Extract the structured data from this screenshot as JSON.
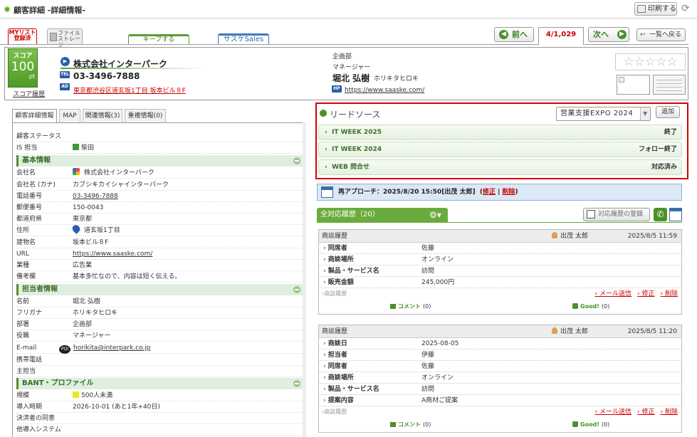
{
  "header": {
    "title": "顧客詳細 -詳細情報-",
    "print_label": "印刷する"
  },
  "toolbar": {
    "mylist_label": "MYリスト",
    "mylist_sub": "登録済",
    "file_label": "ファイル",
    "file_sub": "ストレージ",
    "keep_label": "キープする",
    "sales_label": "サスケSales"
  },
  "pager": {
    "prev_label": "前へ",
    "count": "4/1,029",
    "next_label": "次へ",
    "back_label": "一覧へ戻る"
  },
  "customer": {
    "score_label": "スコア",
    "score_value": "100",
    "score_unit": "pt",
    "score_history": "スコア履歴",
    "company": "株式会社インターパーク",
    "tel_icon": "TEL",
    "tel": "03-3496-7888",
    "address_icon": "AD",
    "address": "東京都渋谷区道玄坂1丁目 坂本ビル８F",
    "department": "企画部",
    "role": "マネージャー",
    "person": "堀北 弘樹",
    "person_kana": "ホリキタヒロキ",
    "url_icon": "HP",
    "url": "https://www.saaske.com/",
    "stars": "☆☆☆☆☆"
  },
  "left_tabs": [
    "顧客詳細情報",
    "MAP",
    "関連情報(3)",
    "重複情報(0)"
  ],
  "details": {
    "status_label": "顧客ステータス",
    "is_label": "IS 担当",
    "is_value": "柴田",
    "is_color": "#3a9a3a",
    "basic_section": "基本情報",
    "basic": [
      {
        "k": "会社名",
        "v": "株式会社インターパーク"
      },
      {
        "k": "会社名 (カナ)",
        "v": "カブシキカイシャインターパーク"
      },
      {
        "k": "電話番号",
        "v": "03-3496-7888"
      },
      {
        "k": "郵便番号",
        "v": "150-0043"
      },
      {
        "k": "都道府県",
        "v": "東京都"
      },
      {
        "k": "住所",
        "v": "道玄坂1丁目"
      },
      {
        "k": "建物名",
        "v": "坂本ビル８F"
      },
      {
        "k": "URL",
        "v": "https://www.saaske.com/"
      },
      {
        "k": "業種",
        "v": "広告業"
      },
      {
        "k": "備考欄",
        "v": "基本多忙なので、内容は短く伝える。"
      }
    ],
    "contact_section": "担当者情報",
    "contact": [
      {
        "k": "名前",
        "v": "堀北 弘樹"
      },
      {
        "k": "フリガナ",
        "v": "ホリキタヒロキ"
      },
      {
        "k": "部署",
        "v": "企画部"
      },
      {
        "k": "役職",
        "v": "マネージャー"
      },
      {
        "k": "E-mail",
        "v": "horikita@interpark.co.jp"
      },
      {
        "k": "携帯電話",
        "v": ""
      },
      {
        "k": "主担当",
        "v": ""
      }
    ],
    "bant_section": "BANT・プロファイル",
    "bant": [
      {
        "k": "規模",
        "v": "500人未満"
      },
      {
        "k": "導入時期",
        "v": "2026-10-01 (あと1年+40日)"
      },
      {
        "k": "決済者の同意",
        "v": ""
      },
      {
        "k": "他導入システム",
        "v": ""
      }
    ],
    "scale_color": "#e8e820"
  },
  "lead": {
    "title": "リードソース",
    "select_value": "営業支援EXPO 2024",
    "add_label": "追加",
    "items": [
      {
        "name": "IT WEEK 2025",
        "status": "終了"
      },
      {
        "name": "IT WEEK 2024",
        "status": "フォロー終了"
      },
      {
        "name": "WEB 問合せ",
        "status": "対応済み"
      }
    ]
  },
  "reapproach": {
    "text": "再アプローチ：2025/8/20 15:50[出茂 太郎]",
    "edit": "修正",
    "delete": "削除"
  },
  "history": {
    "tab_label": "全対応履歴（20）",
    "register_label": "対応履歴の登録",
    "cards": [
      {
        "type": "商談履歴",
        "who": "出茂 太郎",
        "datetime": "2025/8/5 11:59",
        "rows": [
          {
            "k": "同席者",
            "v": "佐藤"
          },
          {
            "k": "商談場所",
            "v": "オンライン"
          },
          {
            "k": "製品・サービス名",
            "v": "訪問"
          },
          {
            "k": "販売金額",
            "v": "245,000円"
          }
        ],
        "foot_label": "商談履歴",
        "mail": "メール送信",
        "edit": "修正",
        "delete": "削除",
        "comment": "コメント",
        "comment_count": "(0)",
        "good": "Good!",
        "good_count": "(0)"
      },
      {
        "type": "商談履歴",
        "who": "出茂 太郎",
        "datetime": "2025/8/5 11:20",
        "rows": [
          {
            "k": "商談日",
            "v": "2025-08-05"
          },
          {
            "k": "担当者",
            "v": "伊藤"
          },
          {
            "k": "同席者",
            "v": "佐藤"
          },
          {
            "k": "商談場所",
            "v": "オンライン"
          },
          {
            "k": "製品・サービス名",
            "v": "訪問"
          },
          {
            "k": "提案内容",
            "v": "A商材ご提案"
          }
        ],
        "foot_label": "商談履歴",
        "mail": "メール送信",
        "edit": "修正",
        "delete": "削除",
        "comment": "コメント",
        "comment_count": "(0)",
        "good": "Good!",
        "good_count": "(0)"
      }
    ]
  }
}
